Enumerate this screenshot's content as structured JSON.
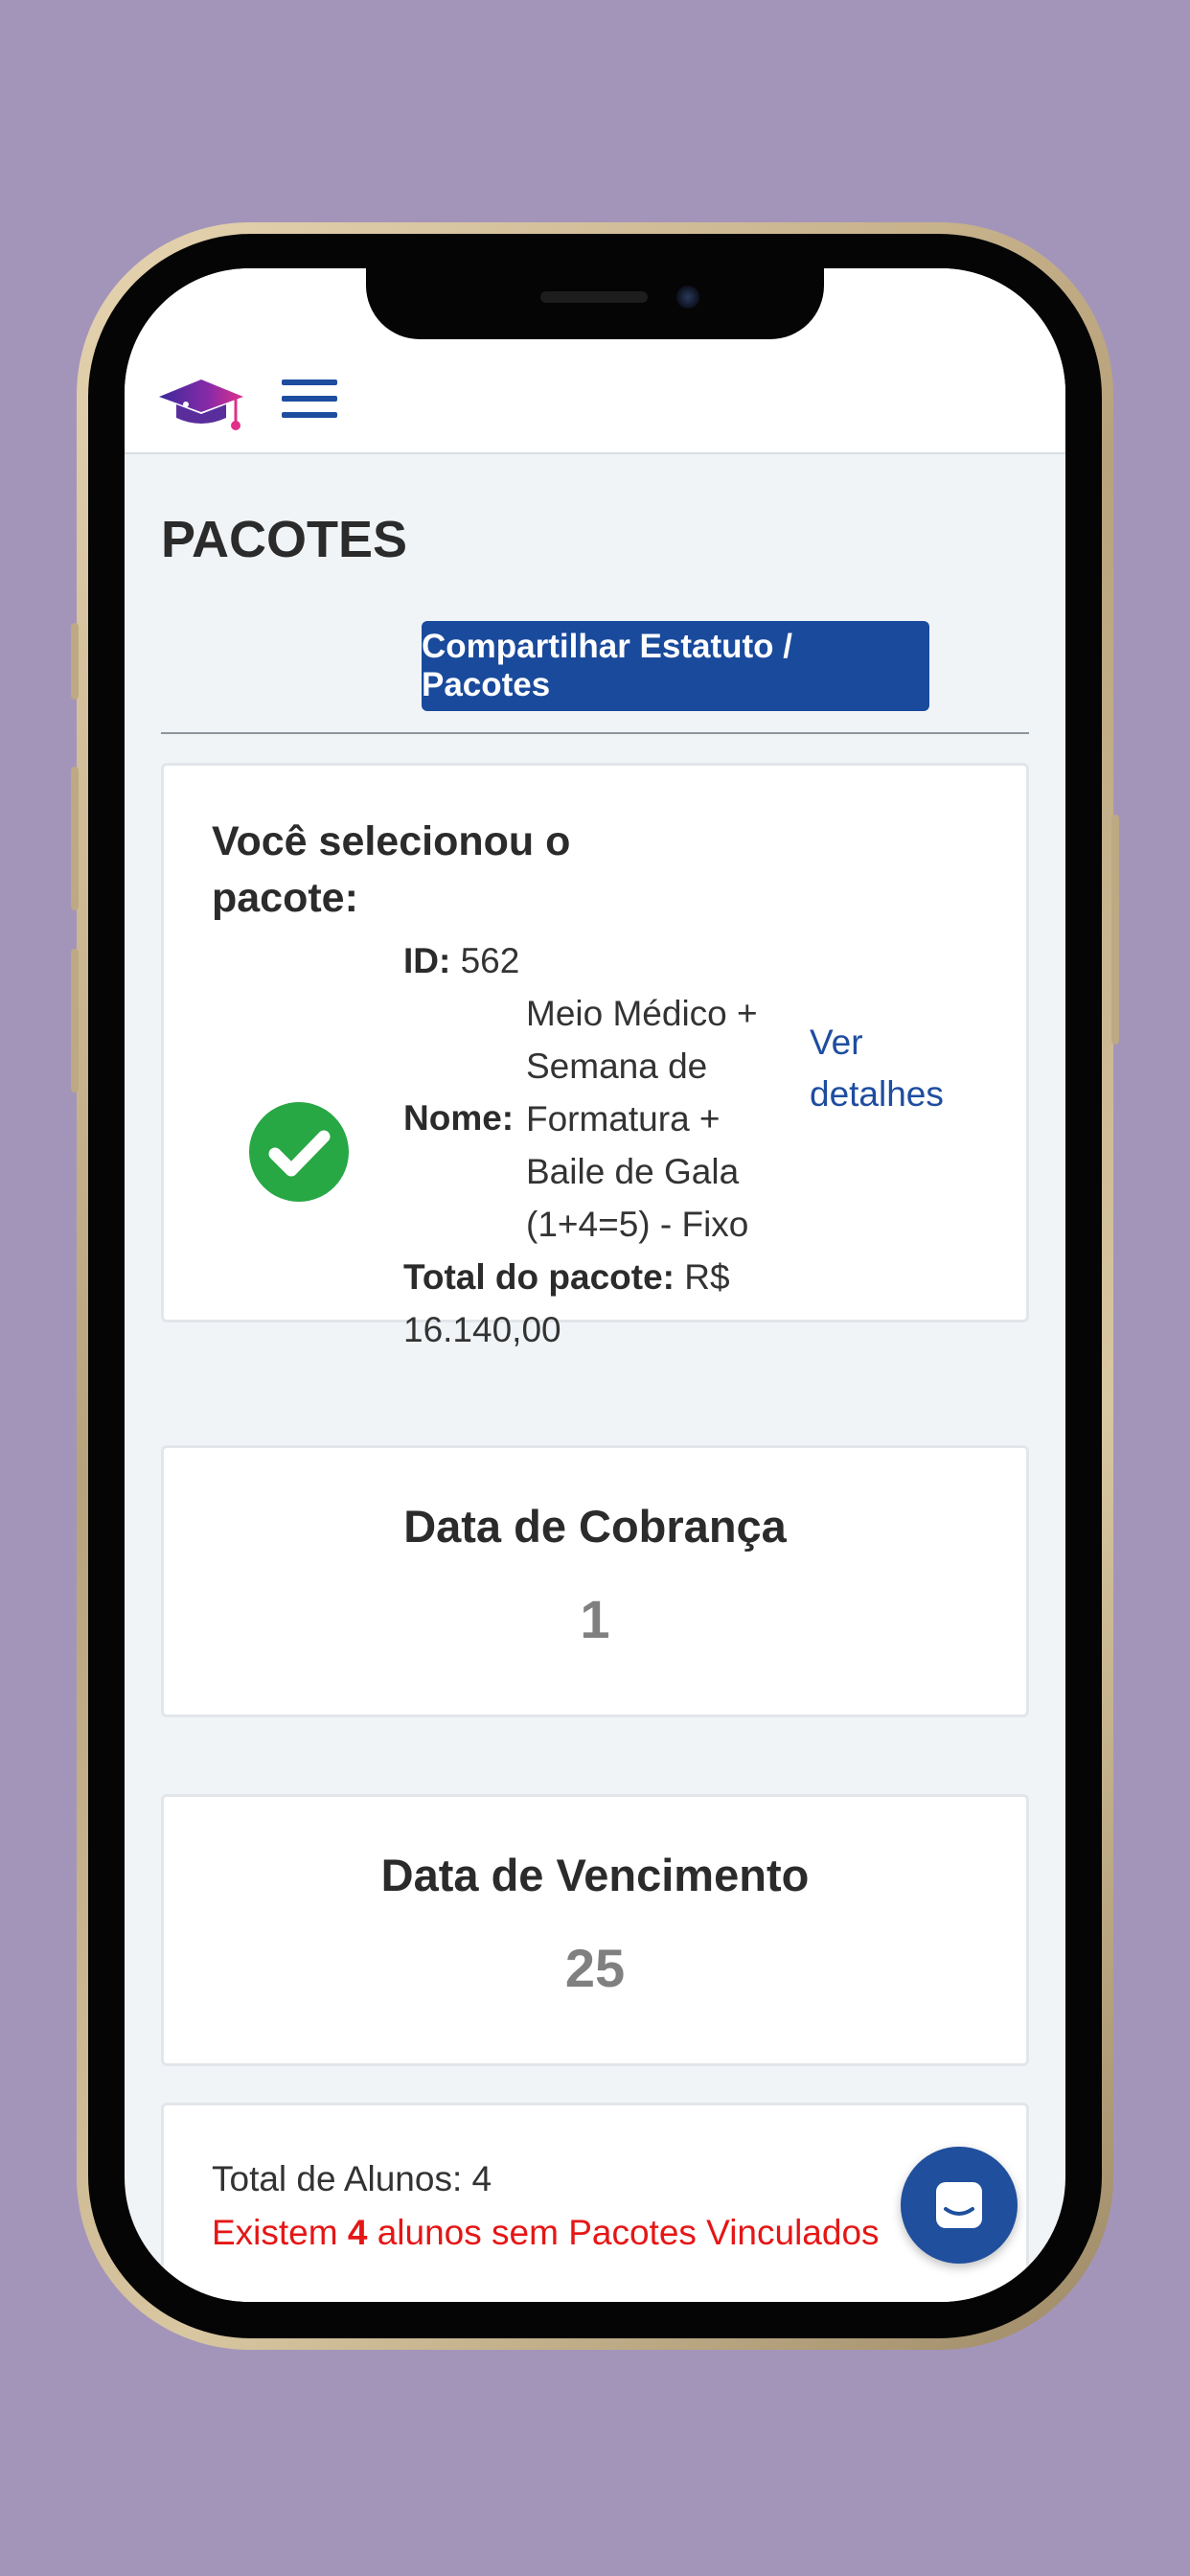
{
  "header": {
    "logo_icon": "graduation-cap-icon",
    "menu_icon": "hamburger-menu-icon"
  },
  "page": {
    "title": "PACOTES",
    "share_button": "Compartilhar Estatuto / Pacotes"
  },
  "selected_package": {
    "heading": "Você selecionou o pacote:",
    "status_icon": "check-circle-icon",
    "id_label": "ID:",
    "id_value": "562",
    "name_label": "Nome:",
    "name_value": "Meio Médico + Semana de Formatura + Baile de Gala (1+4=5) - Fixo",
    "total_label": "Total do pacote:",
    "total_value": "R$ 16.140,00",
    "details_link": "Ver detalhes"
  },
  "billing_date": {
    "title": "Data de Cobrança",
    "value": "1"
  },
  "due_date": {
    "title": "Data de Vencimento",
    "value": "25"
  },
  "students": {
    "total_text": "Total de Alunos: 4",
    "warning_prefix": "Existem",
    "warning_count": "4",
    "warning_suffix": "alunos sem Pacotes Vinculados"
  },
  "chat": {
    "icon": "chat-icon"
  },
  "colors": {
    "background": "#a395b9",
    "primary": "#1a4a9c",
    "success": "#28a745",
    "warning_text": "#e51616"
  }
}
